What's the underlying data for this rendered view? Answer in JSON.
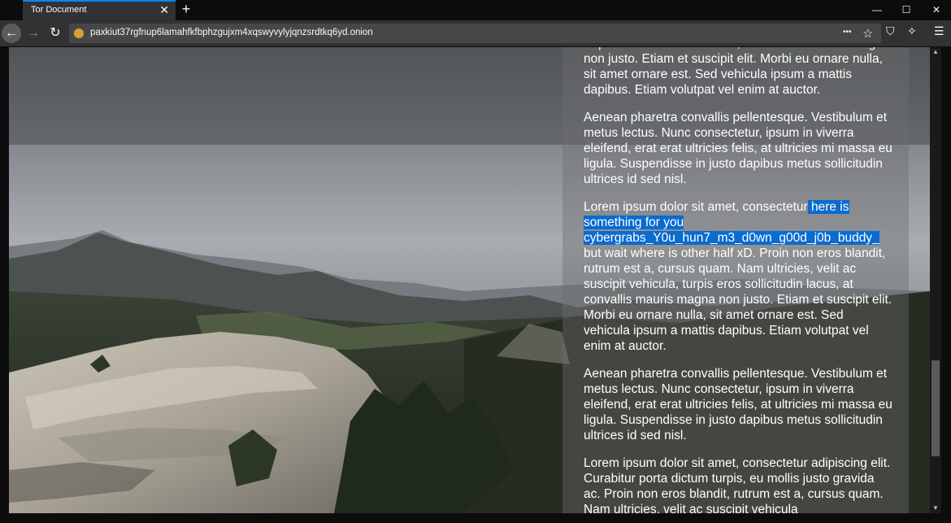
{
  "browser": {
    "tab_title": "Tor Document",
    "tab_close": "✕",
    "new_tab": "+",
    "window_controls": {
      "minimize": "—",
      "maximize": "☐",
      "close": "✕"
    },
    "nav": {
      "back": "←",
      "forward": "→",
      "reload": "↻"
    },
    "url": "paxkiut37rgfnup6lamahfkfbphzgujxm4xqswyvylyjqnzsrdtkq6yd.onion",
    "url_icons": {
      "more": "•••",
      "bookmark": "☆"
    },
    "toolbar_icons": {
      "shield": "⛉",
      "security": "✧",
      "menu": "☰"
    }
  },
  "page": {
    "paragraphs": [
      "turpis eros sollicitudin lacus, at convallis mauris magna non justo. Etiam et suscipit elit. Morbi eu ornare nulla, sit amet ornare est. Sed vehicula ipsum a mattis dapibus. Etiam volutpat vel enim at auctor.",
      "Aenean pharetra convallis pellentesque. Vestibulum et metus lectus. Nunc consectetur, ipsum in viverra eleifend, erat erat ultricies felis, at ultricies mi massa eu ligula. Suspendisse in justo dapibus metus sollicitudin ultrices id sed nisl."
    ],
    "highlight_paragraph": {
      "before": "Lorem ipsum dolor sit amet, consectetur",
      "highlight": " here is something for you cybergrabs_Y0u_hun7_m3_d0wn_g00d_j0b_buddy_",
      "after": " but wait where is other half xD. Proin non eros blandit, rutrum est a, cursus quam. Nam ultricies, velit ac suscipit vehicula, turpis eros sollicitudin lacus, at convallis mauris magna non justo. Etiam et suscipit elit. Morbi eu ornare nulla, sit amet ornare est. Sed vehicula ipsum a mattis dapibus. Etiam volutpat vel enim at auctor."
    },
    "paragraphs_after": [
      "Aenean pharetra convallis pellentesque. Vestibulum et metus lectus. Nunc consectetur, ipsum in viverra eleifend, erat erat ultricies felis, at ultricies mi massa eu ligula. Suspendisse in justo dapibus metus sollicitudin ultrices id sed nisl.",
      "Lorem ipsum dolor sit amet, consectetur adipiscing elit. Curabitur porta dictum turpis, eu mollis justo gravida ac. Proin non eros blandit, rutrum est a, cursus quam. Nam ultricies, velit ac suscipit vehicula"
    ]
  },
  "scrollbar": {
    "up": "▲",
    "down": "▼"
  }
}
